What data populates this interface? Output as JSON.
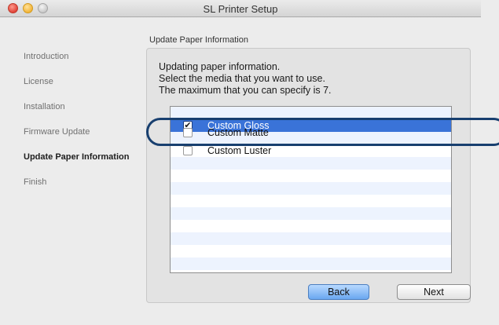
{
  "window": {
    "title": "SL Printer Setup"
  },
  "sidebar": {
    "items": [
      {
        "label": "Introduction",
        "active": false
      },
      {
        "label": "License",
        "active": false
      },
      {
        "label": "Installation",
        "active": false
      },
      {
        "label": "Firmware Update",
        "active": false
      },
      {
        "label": "Update Paper Information",
        "active": true
      },
      {
        "label": "Finish",
        "active": false
      }
    ]
  },
  "main": {
    "section_title": "Update Paper Information",
    "message": [
      "Updating paper information.",
      "Select the media that you want to use.",
      "The maximum that you can specify is 7."
    ],
    "media_list": [
      {
        "label": "Custom Gloss",
        "checked": true,
        "selected": true
      },
      {
        "label": "Custom Matte",
        "checked": false,
        "selected": false
      },
      {
        "label": "Custom Luster",
        "checked": false,
        "selected": false
      }
    ]
  },
  "buttons": {
    "back": "Back",
    "next": "Next"
  },
  "colors": {
    "selection": "#3a73d8",
    "callout": "#183f6f",
    "default_button": "#6aa7f0"
  }
}
